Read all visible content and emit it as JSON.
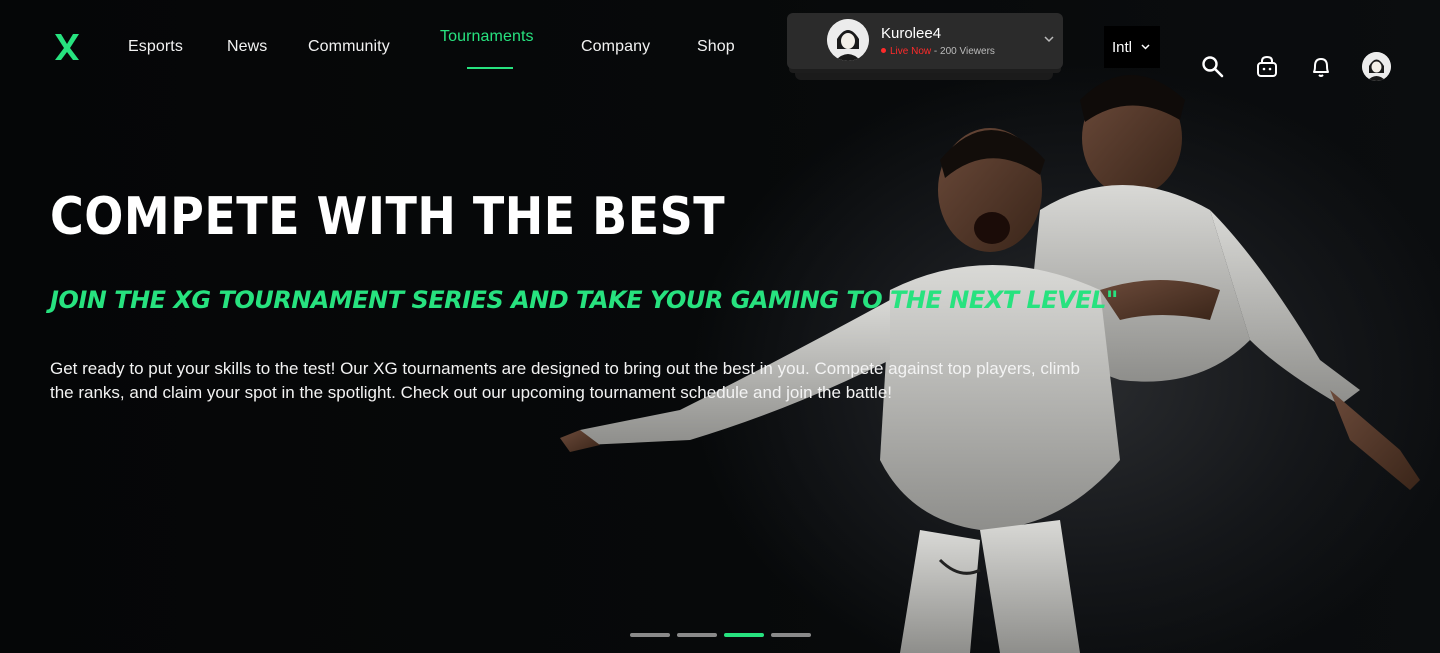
{
  "nav": {
    "links": [
      {
        "label": "Esports",
        "active": false
      },
      {
        "label": "News",
        "active": false
      },
      {
        "label": "Community",
        "active": false
      },
      {
        "label": "Tournaments",
        "active": true
      },
      {
        "label": "Company",
        "active": false
      },
      {
        "label": "Shop",
        "active": false
      }
    ],
    "accent_color": "#27e27f"
  },
  "stream": {
    "streamer": "Kurolee4",
    "live_label": "Live Now",
    "separator": "-",
    "viewers": "200 Viewers"
  },
  "region": {
    "label": "Intl"
  },
  "icons": [
    "search-icon",
    "cart-icon",
    "notification-bell-icon",
    "profile-avatar"
  ],
  "hero": {
    "title": "COMPETE WITH THE BEST",
    "subtitle": "JOIN THE XG TOURNAMENT SERIES AND TAKE YOUR GAMING TO THE NEXT LEVEL\"",
    "body": "Get ready to put your skills to the test! Our XG tournaments are designed to bring out the best in you. Compete against top players, climb the ranks, and claim your spot in the spotlight. Check out our upcoming tournament schedule and join the battle!"
  },
  "carousel": {
    "slides": 4,
    "active_index": 2
  }
}
